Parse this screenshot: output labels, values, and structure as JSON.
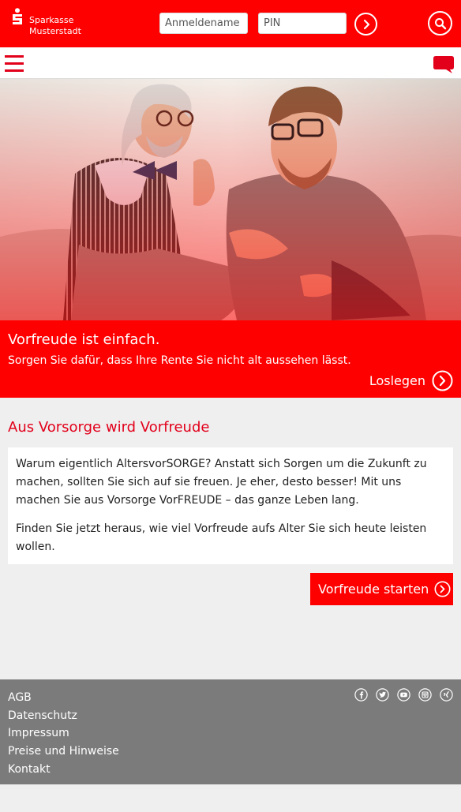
{
  "brand": {
    "line1": "Sparkasse",
    "line2": "Musterstadt",
    "logo_icon": "sparkasse-s-logo"
  },
  "login": {
    "username_placeholder": "Anmeldename",
    "pin_placeholder": "PIN",
    "submit_icon": "chevron-right-icon",
    "search_icon": "search-icon"
  },
  "nav": {
    "menu_icon": "hamburger-menu-icon",
    "chat_icon": "chat-bubble-icon"
  },
  "teaser": {
    "title": "Vorfreude ist einfach.",
    "subtitle": "Sorgen Sie dafür, dass Ihre Rente Sie nicht alt aussehen lässt.",
    "cta_label": "Loslegen"
  },
  "main": {
    "heading": "Aus Vorsorge wird Vorfreude",
    "paragraphs": [
      "Warum eigentlich AltersvorSORGE? Anstatt sich Sorgen um die Zukunft zu machen, sollten Sie sich auf sie freuen. Je eher, desto besser! Mit uns machen Sie aus Vorsorge VorFREUDE – das ganze Leben lang.",
      "Finden Sie jetzt heraus, wie viel Vorfreude aufs Alter Sie sich heute leisten wollen."
    ],
    "cta_label": "Vorfreude starten"
  },
  "footer": {
    "links": [
      "AGB",
      "Datenschutz",
      "Impressum",
      "Preise und Hinweise",
      "Kontakt"
    ],
    "social_icons": [
      "facebook-icon",
      "twitter-icon",
      "youtube-icon",
      "instagram-icon",
      "xing-icon"
    ]
  },
  "colors": {
    "brand_red": "#ff0000",
    "heading_red": "#e2001a",
    "footer_gray": "#7b7b7b",
    "page_bg": "#efefef"
  }
}
